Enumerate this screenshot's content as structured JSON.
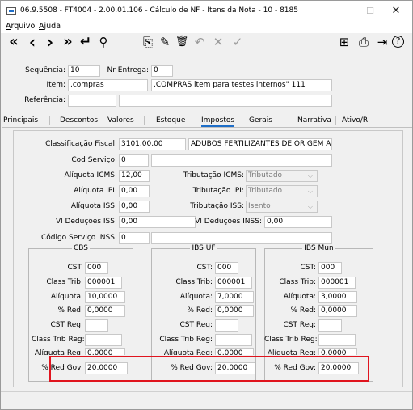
{
  "window": {
    "title": "06.9.5508 - FT4004 - 2.00.01.106 - Cálculo de NF - Itens da Nota - 10 - 8185",
    "minimize": "—",
    "maximize": "☐",
    "close": "✕"
  },
  "menu": [
    "Arquivo",
    "Ajuda"
  ],
  "toolbar_icons": {
    "first": "«",
    "prev": "‹",
    "next": "›",
    "last": "»",
    "return": "↵",
    "search": "⚲",
    "new": "⎘",
    "edit": "✎",
    "delete": "🗑",
    "undo": "↶",
    "cancel": "✕",
    "confirm": "✓",
    "tree": "⊞",
    "print": "⎙",
    "exit": "⇥",
    "help": "?"
  },
  "header": {
    "sequencia_label": "Sequência:",
    "sequencia_value": "10",
    "nr_entrega_label": "Nr Entrega:",
    "nr_entrega_value": "0",
    "item_label": "Item:",
    "item_code": ".compras",
    "item_desc": ".COMPRAS item para testes internos\" 111",
    "referencia_label": "Referência:",
    "referencia_code": "",
    "referencia_desc": ""
  },
  "tabs": [
    "Principais",
    "Descontos",
    "Valores",
    "Estoque",
    "Impostos",
    "Gerais",
    "Narrativa",
    "Ativo/RI"
  ],
  "selected_tab": "Impostos",
  "impostos": {
    "class_fiscal_label": "Classificação Fiscal:",
    "class_fiscal_value": "3101.00.00",
    "class_fiscal_desc": "ADUBOS FERTILIZANTES DE ORIGEM ANIM",
    "cod_servico_label": "Cod Serviço:",
    "cod_servico_value": "0",
    "cod_servico_desc": "",
    "aliq_icms_label": "Alíquota ICMS:",
    "aliq_icms_value": "12,00",
    "trib_icms_label": "Tributação ICMS:",
    "trib_icms_value": "Tributado",
    "aliq_ipi_label": "Alíquota IPI:",
    "aliq_ipi_value": "0,00",
    "trib_ipi_label": "Tributação IPI:",
    "trib_ipi_value": "Tributado",
    "aliq_iss_label": "Alíquota ISS:",
    "aliq_iss_value": "0,00",
    "trib_iss_label": "Tributação ISS:",
    "trib_iss_value": "Isento",
    "vl_ded_iss_label": "Vl Deduções ISS:",
    "vl_ded_iss_value": "0,00",
    "vl_ded_inss_label": "Vl Deduções INSS:",
    "vl_ded_inss_value": "0,00",
    "cod_serv_inss_label": "Código Serviço INSS:",
    "cod_serv_inss_value": "0",
    "cod_serv_inss_desc": ""
  },
  "groups": [
    {
      "title": "CBS",
      "cst_label": "CST:",
      "cst": "000",
      "class_trib_label": "Class Trib:",
      "class_trib": "000001",
      "aliquota_label": "Alíquota:",
      "aliquota": "10,0000",
      "red_label": "% Red:",
      "red": "0,0000",
      "cst_reg_label": "CST Reg:",
      "cst_reg": "",
      "class_trib_reg_label": "Class Trib Reg:",
      "class_trib_reg": "",
      "aliquota_reg_label": "Alíquota Reg:",
      "aliquota_reg": "0,0000",
      "red_gov_label": "% Red Gov:",
      "red_gov": "20,0000"
    },
    {
      "title": "IBS UF",
      "cst_label": "CST:",
      "cst": "000",
      "class_trib_label": "Class Trib:",
      "class_trib": "000001",
      "aliquota_label": "Alíquota:",
      "aliquota": "7,0000",
      "red_label": "% Red:",
      "red": "0,0000",
      "cst_reg_label": "CST Reg:",
      "cst_reg": "",
      "class_trib_reg_label": "Class Trib Reg:",
      "class_trib_reg": "",
      "aliquota_reg_label": "Alíquota Reg:",
      "aliquota_reg": "0,0000",
      "red_gov_label": "% Red Gov:",
      "red_gov": "20,0000"
    },
    {
      "title": "IBS Mun",
      "cst_label": "CST:",
      "cst": "000",
      "class_trib_label": "Class Trib:",
      "class_trib": "000001",
      "aliquota_label": "Alíquota:",
      "aliquota": "3,0000",
      "red_label": "% Red:",
      "red": "0,0000",
      "cst_reg_label": "CST Reg:",
      "cst_reg": "",
      "class_trib_reg_label": "Class Trib Reg:",
      "class_trib_reg": "",
      "aliquota_reg_label": "Alíquota Reg:",
      "aliquota_reg": "0,0000",
      "red_gov_label": "% Red Gov:",
      "red_gov": "20,0000"
    }
  ],
  "colors": {
    "highlight": "#e0141e",
    "tab_accent": "#1e6ec8"
  }
}
